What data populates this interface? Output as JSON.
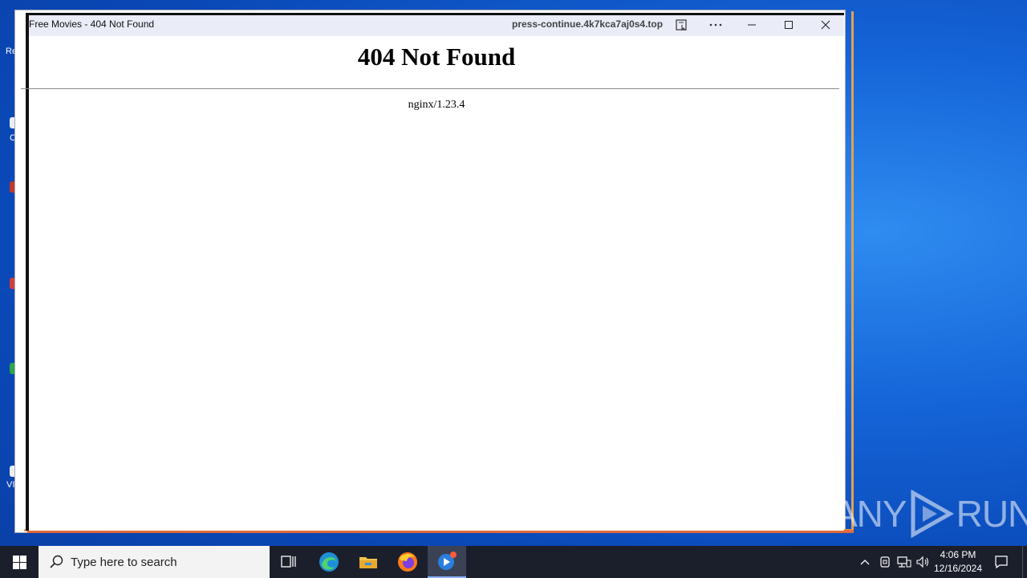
{
  "desktop": {
    "fragments": [
      "Re",
      "C",
      "VI"
    ]
  },
  "popup": {
    "title": "Free Movies - 404 Not Found",
    "url": "press-continue.4k7kca7aj0s4.top",
    "controls": {
      "reader_icon": "reader-view-icon",
      "more_icon": "more-icon",
      "minimize_icon": "minimize-icon",
      "maximize_icon": "maximize-icon",
      "close_icon": "close-icon"
    },
    "page": {
      "heading": "404 Not Found",
      "server": "nginx/1.23.4"
    }
  },
  "watermark": {
    "text_left": "ANY",
    "text_right": "RUN"
  },
  "taskbar": {
    "search_placeholder": "Type here to search",
    "clock_time": "4:06 PM",
    "clock_date": "12/16/2024"
  },
  "colors": {
    "desktop_blue": "#1565d8",
    "taskbar": "#1b1f2b",
    "titlebar": "#eaecf8",
    "frame_orange": "#e6a04a"
  }
}
